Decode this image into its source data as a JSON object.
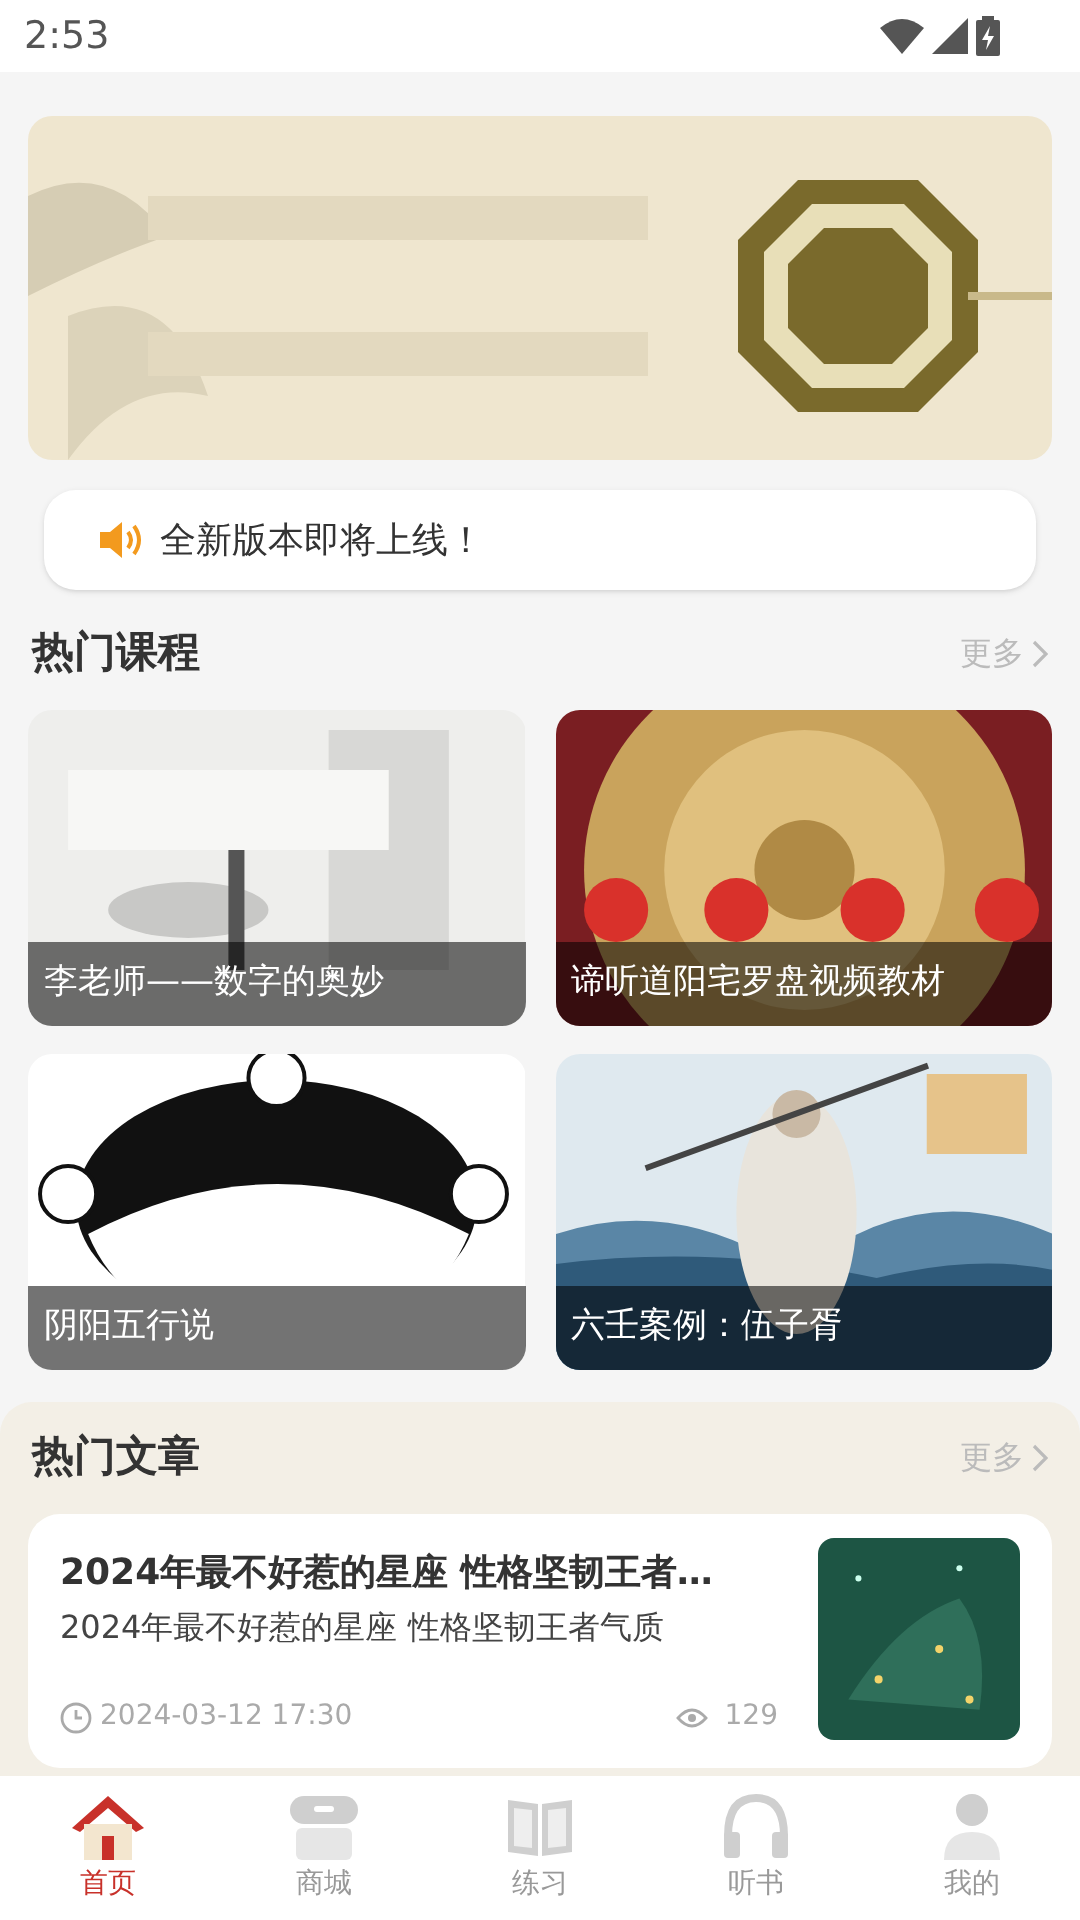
{
  "status_bar": {
    "time": "2:53"
  },
  "notice": {
    "text": "全新版本即将上线！"
  },
  "courses": {
    "title": "热门课程",
    "more": "更多",
    "items": [
      {
        "caption": "李老师——数字的奥妙"
      },
      {
        "caption": "谛听道阳宅罗盘视频教材"
      },
      {
        "caption": "阴阳五行说"
      },
      {
        "caption": "六壬案例：伍子胥"
      }
    ]
  },
  "articles": {
    "title": "热门文章",
    "more": "更多",
    "items": [
      {
        "title": "2024年最不好惹的星座 性格坚韧王者…",
        "summary": "2024年最不好惹的星座 性格坚韧王者气质",
        "time": "2024-03-12 17:30",
        "views": "129"
      }
    ]
  },
  "tab_bar": [
    {
      "label": "首页",
      "selected": true
    },
    {
      "label": "商城",
      "selected": false
    },
    {
      "label": "练习",
      "selected": false
    },
    {
      "label": "听书",
      "selected": false
    },
    {
      "label": "我的",
      "selected": false
    }
  ]
}
